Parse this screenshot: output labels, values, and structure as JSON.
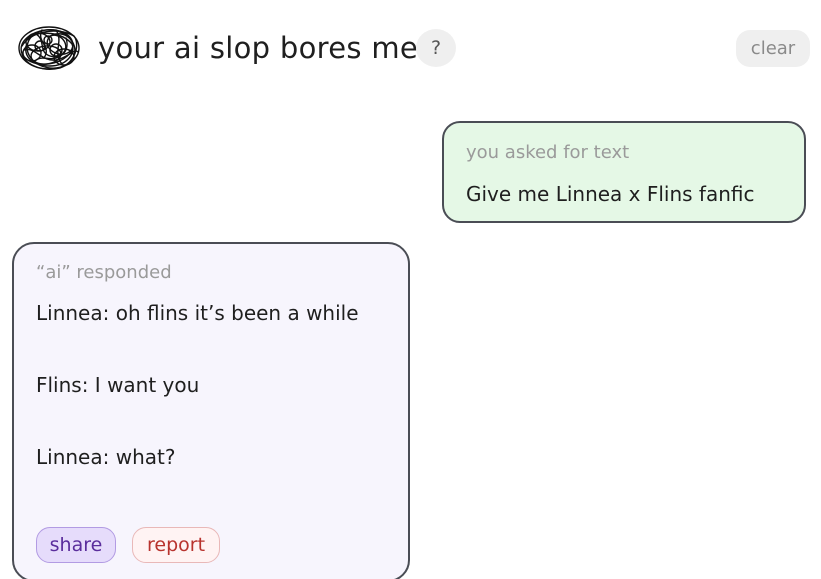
{
  "header": {
    "logo_icon": "scribble-logo-icon",
    "title": "your ai slop bores me",
    "help_label": "?",
    "clear_label": "clear"
  },
  "user_message": {
    "caption": "you asked for text",
    "text": "Give me Linnea x Flins fanfic"
  },
  "ai_message": {
    "caption": "“ai” responded",
    "lines": [
      "Linnea: oh flins it’s been a while",
      "Flins: I want you",
      "Linnea: what?"
    ],
    "share_label": "share",
    "report_label": "report"
  },
  "colors": {
    "user_bubble_bg": "#e5f8e6",
    "ai_bubble_bg": "#f7f5fd",
    "share_accent": "#5a2d9c",
    "report_accent": "#b8332e"
  }
}
